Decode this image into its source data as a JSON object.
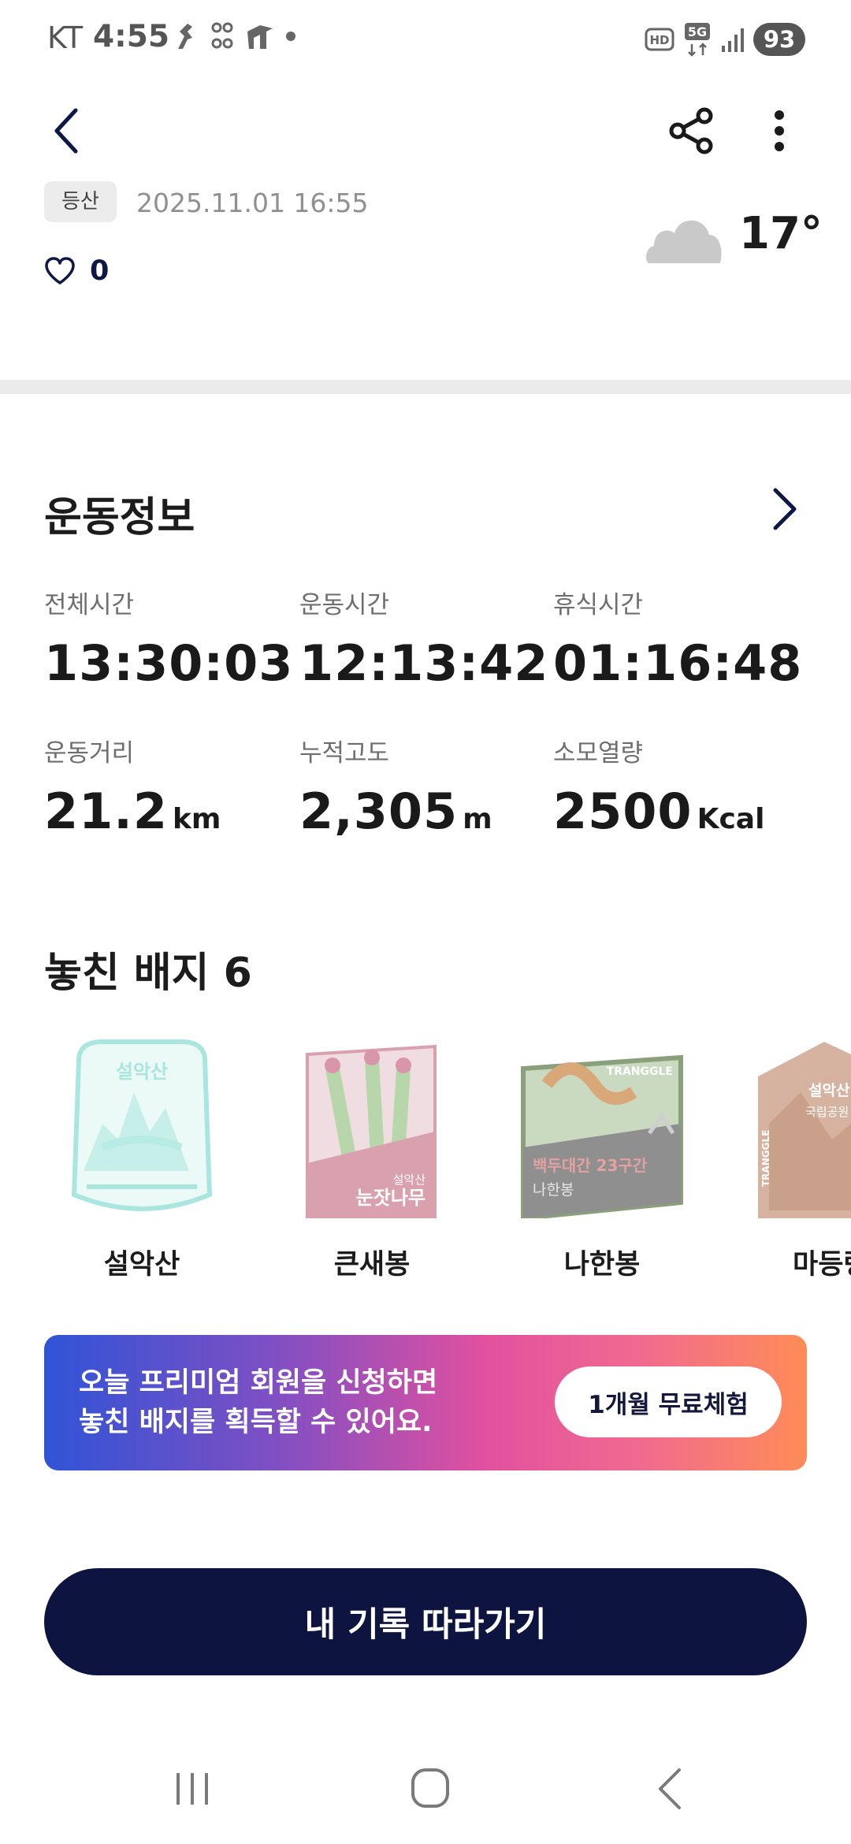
{
  "status_bar": {
    "carrier": "KT",
    "time": "4:55",
    "battery": "93",
    "left_icons": [
      "running-app-icon",
      "app-notification-icon",
      "tranggle-app-icon",
      "dot-icon"
    ],
    "right_icons": [
      "hd-voice-icon",
      "5g-data-icon",
      "signal-icon"
    ]
  },
  "activity": {
    "category": "등산",
    "datetime": "2025.11.01 16:55",
    "likes": "0",
    "temperature": "17°",
    "weather_icon": "cloud-icon"
  },
  "stats": {
    "title": "운동정보",
    "items": [
      {
        "label": "전체시간",
        "value": "13:30:03",
        "unit": ""
      },
      {
        "label": "운동시간",
        "value": "12:13:42",
        "unit": ""
      },
      {
        "label": "휴식시간",
        "value": "01:16:48",
        "unit": ""
      },
      {
        "label": "운동거리",
        "value": "21.2",
        "unit": "km"
      },
      {
        "label": "누적고도",
        "value": "2,305",
        "unit": "m"
      },
      {
        "label": "소모열량",
        "value": "2500",
        "unit": "Kcal"
      }
    ]
  },
  "badges": {
    "title": "놓친 배지 6",
    "items": [
      {
        "name": "설악산",
        "image_text": [
          "설악산"
        ]
      },
      {
        "name": "큰새봉",
        "image_text": [
          "설악산",
          "눈잣나무"
        ]
      },
      {
        "name": "나한봉",
        "image_text": [
          "TRANGGLE",
          "백두대간 23구간",
          "나한봉"
        ]
      },
      {
        "name": "마등령",
        "image_text": [
          "설악산",
          "국립공원",
          "TRANGGLE"
        ]
      }
    ]
  },
  "promo": {
    "line1": "오늘 프리미엄 회원을 신청하면",
    "line2": "놓친 배지를 획득할 수 있어요.",
    "button": "1개월 무료체험"
  },
  "follow_button": "내 기록 따라가기",
  "colors": {
    "navy": "#0d1440",
    "promo_gradient": [
      "#2f54d6",
      "#e2509f",
      "#ff8c57"
    ],
    "badge_mint": "#a8e6df",
    "badge_pink": "#d9a0ad",
    "badge_olive": "#8aa07a",
    "badge_brown": "#c9a08a"
  }
}
